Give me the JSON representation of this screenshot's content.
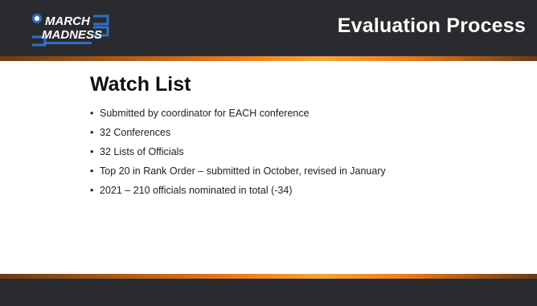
{
  "header": {
    "title": "Evaluation Process",
    "logo_text_line1": "MARCH",
    "logo_text_line2": "MADNESS"
  },
  "content": {
    "heading": "Watch List",
    "bullets": [
      "Submitted by coordinator for EACH conference",
      "32 Conferences",
      "32 Lists of Officials",
      "Top 20 in Rank Order – submitted in October, revised in January",
      "2021 – 210 officials nominated in total (-34)"
    ]
  },
  "colors": {
    "bar": "#2a2b2e",
    "accent": "#f07c1d",
    "logo_blue": "#2f6fc9"
  }
}
